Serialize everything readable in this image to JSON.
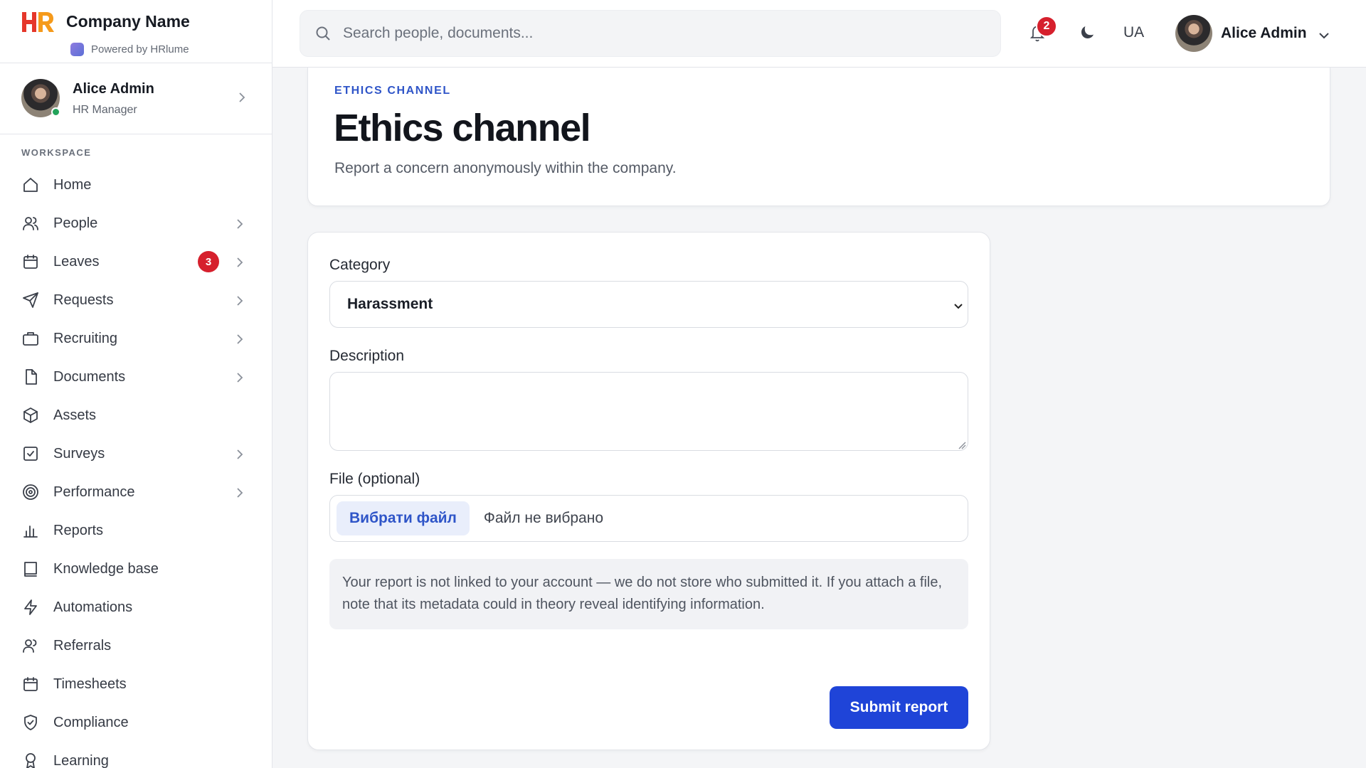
{
  "brand": {
    "name": "Company Name",
    "powered_by": "Powered by HRlume",
    "logo_text": "HR"
  },
  "sidebar_user": {
    "name": "Alice Admin",
    "role": "HR Manager",
    "status": "online"
  },
  "sidebar": {
    "section_label": "WORKSPACE",
    "items": [
      {
        "label": "Home",
        "icon": "home-icon",
        "chevron": false
      },
      {
        "label": "People",
        "icon": "people-icon",
        "chevron": true
      },
      {
        "label": "Leaves",
        "icon": "calendar-icon",
        "chevron": true,
        "badge": "3"
      },
      {
        "label": "Requests",
        "icon": "send-icon",
        "chevron": true
      },
      {
        "label": "Recruiting",
        "icon": "briefcase-icon",
        "chevron": true
      },
      {
        "label": "Documents",
        "icon": "document-icon",
        "chevron": true
      },
      {
        "label": "Assets",
        "icon": "box-icon",
        "chevron": false
      },
      {
        "label": "Surveys",
        "icon": "checkbox-icon",
        "chevron": true
      },
      {
        "label": "Performance",
        "icon": "target-icon",
        "chevron": true
      },
      {
        "label": "Reports",
        "icon": "bar-chart-icon",
        "chevron": false
      },
      {
        "label": "Knowledge base",
        "icon": "book-icon",
        "chevron": false
      },
      {
        "label": "Automations",
        "icon": "lightning-icon",
        "chevron": false
      },
      {
        "label": "Referrals",
        "icon": "users-icon",
        "chevron": false
      },
      {
        "label": "Timesheets",
        "icon": "calendar-icon",
        "chevron": false
      },
      {
        "label": "Compliance",
        "icon": "shield-check-icon",
        "chevron": false
      },
      {
        "label": "Learning",
        "icon": "award-icon",
        "chevron": false
      }
    ]
  },
  "topbar": {
    "search_placeholder": "Search people, documents...",
    "notifications_count": "2",
    "language": "UA",
    "user_name": "Alice Admin"
  },
  "page": {
    "eyebrow": "ETHICS CHANNEL",
    "title": "Ethics channel",
    "subtitle": "Report a concern anonymously within the company."
  },
  "form": {
    "category_label": "Category",
    "category_value": "Harassment",
    "description_label": "Description",
    "description_value": "",
    "file_label": "File (optional)",
    "file_button": "Вибрати файл",
    "file_status": "Файл не вибрано",
    "notice": "Your report is not linked to your account — we do not store who submitted it. If you attach a file, note that its metadata could in theory reveal identifying information.",
    "submit_label": "Submit report"
  },
  "colors": {
    "accent": "#1f44d8",
    "eyebrow": "#2f55c8",
    "badge": "#d6202d",
    "online": "#22a35a",
    "logo_orange": "#f59a1b",
    "logo_red": "#e5372b"
  }
}
